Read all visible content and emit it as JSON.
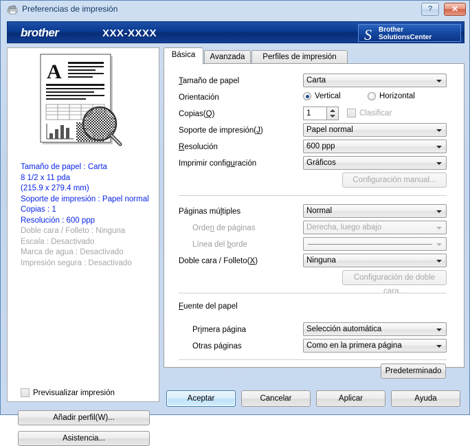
{
  "window": {
    "title": "Preferencias de impresión",
    "title_icon": "printer-icon",
    "help_label": "?",
    "close_label": "✕"
  },
  "banner": {
    "logo": "brother",
    "model": "XXX-XXXX",
    "solutions_mark": "S",
    "solutions_line1": "Brother",
    "solutions_line2": "SolutionsCenter"
  },
  "left_panel": {
    "summary": [
      {
        "text": "Tamaño de papel : Carta",
        "state": "on"
      },
      {
        "text": "8 1/2 x 11 pda",
        "state": "on"
      },
      {
        "text": "(215.9 x 279.4 mm)",
        "state": "on"
      },
      {
        "text": "Soporte de impresión : Papel normal",
        "state": "on"
      },
      {
        "text": "Copias : 1",
        "state": "on"
      },
      {
        "text": "Resolución : 600 ppp",
        "state": "on"
      },
      {
        "text": "Doble cara / Folleto : Ninguna",
        "state": "off"
      },
      {
        "text": "Escala : Desactivado",
        "state": "off"
      },
      {
        "text": "Marca de agua : Desactivado",
        "state": "off"
      },
      {
        "text": "Impresión segura : Desactivado",
        "state": "off"
      }
    ],
    "preview_checkbox": {
      "label": "Previsualizar impresión",
      "checked": false
    },
    "add_profile_label": "Añadir perfil(W)...",
    "support_label": "Asistencia..."
  },
  "tabs": [
    {
      "label": "Básica",
      "active": true
    },
    {
      "label": "Avanzada",
      "active": false
    },
    {
      "label": "Perfiles de impresión",
      "active": false
    }
  ],
  "form": {
    "paper_size": {
      "label": "Tamaño de papel",
      "value": "Carta"
    },
    "orientation": {
      "label": "Orientación",
      "portrait": "Vertical",
      "landscape": "Horizontal",
      "selected": "Vertical"
    },
    "copies": {
      "label": "Copias(Q)",
      "value": "1",
      "collate_label": "Clasificar",
      "collate_checked": false
    },
    "media_type": {
      "label": "Soporte de impresión(J)",
      "value": "Papel normal"
    },
    "resolution": {
      "label": "Resolución",
      "value": "600 ppp"
    },
    "print_settings": {
      "label": "Imprimir configuración",
      "value": "Gráficos"
    },
    "manual_settings_button": {
      "label": "Configuración manual...",
      "enabled": false
    },
    "multiple_pages": {
      "label": "Páginas múltiples",
      "value": "Normal"
    },
    "page_order": {
      "label": "Orden de páginas",
      "value": "Derecha, luego abajo",
      "enabled": false
    },
    "border_line": {
      "label": "Línea del borde",
      "value": "",
      "enabled": false
    },
    "duplex_booklet": {
      "label": "Doble cara / Folleto(X)",
      "value": "Ninguna"
    },
    "duplex_settings_button": {
      "label": "Configuración de doble cara...",
      "enabled": false
    },
    "paper_source": {
      "label": "Fuente del papel",
      "first_page_label": "Primera página",
      "first_page_value": "Selección automática",
      "other_pages_label": "Otras páginas",
      "other_pages_value": "Como en la primera página"
    },
    "default_button": {
      "label": "Predeterminado"
    }
  },
  "footer_buttons": [
    {
      "label": "Aceptar",
      "default": true
    },
    {
      "label": "Cancelar",
      "default": false
    },
    {
      "label": "Aplicar",
      "default": false
    },
    {
      "label": "Ayuda",
      "default": false
    }
  ],
  "colors": {
    "summary_active": "#0a24e8",
    "summary_inactive": "#a6a6a6",
    "banner_blue": "#0b3a91",
    "window_border": "#5c87b8"
  }
}
